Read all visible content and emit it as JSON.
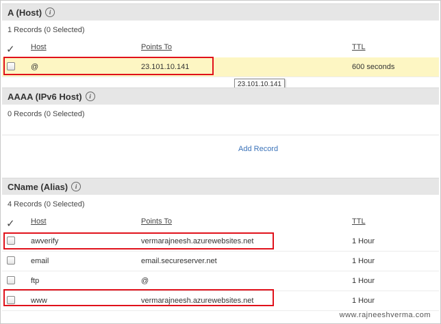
{
  "a_host": {
    "title": "A (Host)",
    "records": "1 Records (0 Selected)",
    "cols": {
      "host": "Host",
      "points_to": "Points To",
      "ttl": "TTL"
    },
    "rows": [
      {
        "host": "@",
        "points_to": "23.101.10.141",
        "ttl": "600 seconds"
      }
    ],
    "tooltip": "23.101.10.141"
  },
  "aaaa": {
    "title": "AAAA (IPv6 Host)",
    "records": "0 Records (0 Selected)",
    "add_record": "Add Record"
  },
  "cname": {
    "title": "CName (Alias)",
    "records": "4 Records (0 Selected)",
    "cols": {
      "host": "Host",
      "points_to": "Points To",
      "ttl": "TTL"
    },
    "rows": [
      {
        "host": "awverify",
        "points_to": "vermarajneesh.azurewebsites.net",
        "ttl": "1 Hour"
      },
      {
        "host": "email",
        "points_to": "email.secureserver.net",
        "ttl": "1 Hour"
      },
      {
        "host": "ftp",
        "points_to": "@",
        "ttl": "1 Hour"
      },
      {
        "host": "www",
        "points_to": "vermarajneesh.azurewebsites.net",
        "ttl": "1 Hour"
      }
    ]
  },
  "watermark": "www.rajneeshverma.com"
}
